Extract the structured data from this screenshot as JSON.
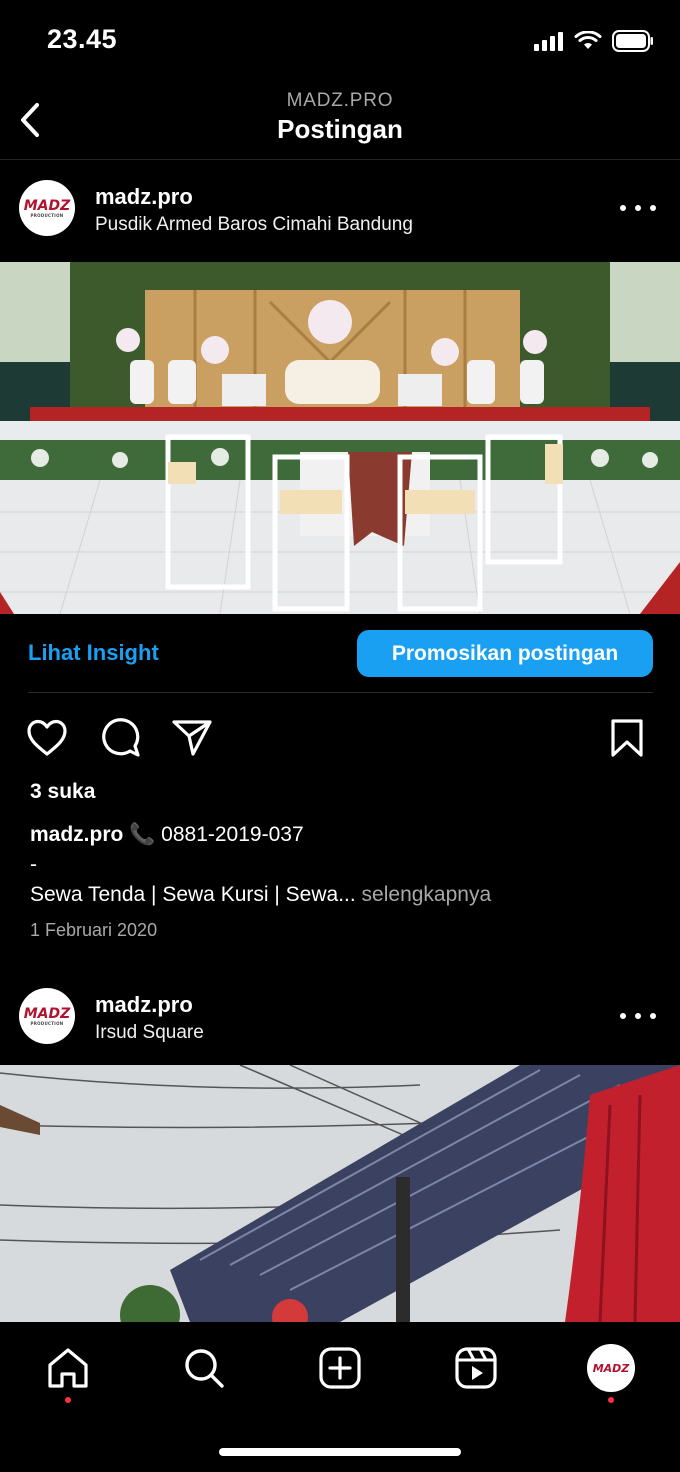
{
  "status": {
    "time": "23.45"
  },
  "nav": {
    "subtitle": "MADZ.PRO",
    "title": "Postingan"
  },
  "brand": {
    "accent": "#1aa0f2",
    "logo_text": "MADZ",
    "logo_sub": "PRODUCTION",
    "logo_color": "#b3122e"
  },
  "posts": [
    {
      "username": "madz.pro",
      "location": "Pusdik Armed Baros Cimahi Bandung"
    },
    {
      "username": "madz.pro",
      "location": "Irsud Square"
    }
  ],
  "insight": {
    "link_label": "Lihat Insight",
    "promote_label": "Promosikan postingan"
  },
  "actions": {
    "icons": [
      "heart-icon",
      "comment-icon",
      "share-icon",
      "bookmark-icon"
    ]
  },
  "post1": {
    "likes": "3 suka",
    "caption_user": "madz.pro",
    "caption_phone": "📞 0881-2019-037",
    "caption_dash": "-",
    "caption_text": "Sewa Tenda | Sewa Kursi | Sewa...",
    "caption_more": "selengkapnya",
    "date": "1 Februari 2020"
  },
  "tabbar": {
    "items": [
      "home-icon",
      "search-icon",
      "create-icon",
      "reels-icon",
      "profile-avatar"
    ]
  }
}
